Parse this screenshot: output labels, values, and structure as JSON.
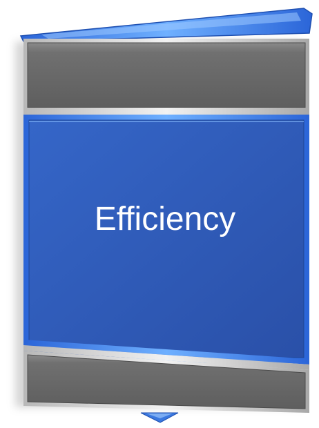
{
  "graphic": {
    "label": "Efficiency",
    "colors": {
      "panel_blue": "#2f5ab8",
      "blue_edge": "#4a90f0",
      "gray_panel": "#6a6a6a",
      "silver_edge": "#cfcfcf",
      "text": "#ffffff"
    }
  }
}
